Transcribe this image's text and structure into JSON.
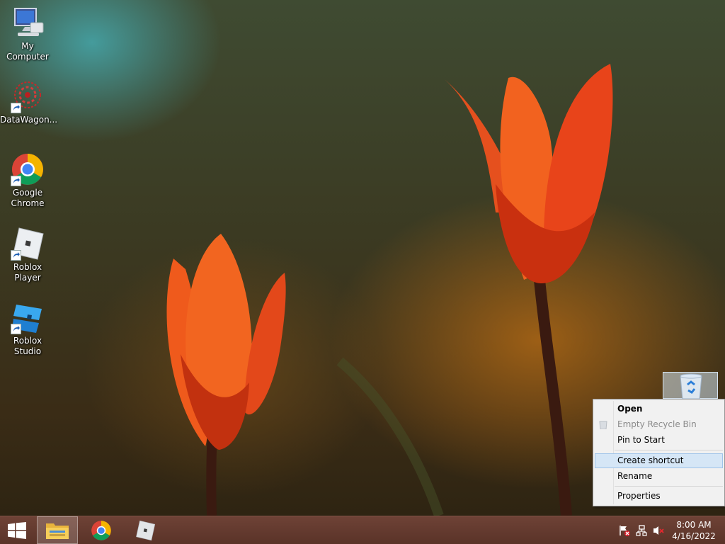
{
  "desktop_icons": [
    {
      "label": "My Computer",
      "icon": "computer-icon",
      "shortcut": false
    },
    {
      "label": "DataWagon...",
      "icon": "datawagon-icon",
      "shortcut": true
    },
    {
      "label": "Google Chrome",
      "icon": "chrome-icon",
      "shortcut": true
    },
    {
      "label": "Roblox Player",
      "icon": "roblox-player-icon",
      "shortcut": true
    },
    {
      "label": "Roblox Studio",
      "icon": "roblox-studio-icon",
      "shortcut": true
    }
  ],
  "recycle_bin": {
    "icon": "recycle-bin-icon",
    "selected": true
  },
  "context_menu": {
    "items": [
      {
        "label": "Open",
        "bold": true,
        "enabled": true
      },
      {
        "label": "Empty Recycle Bin",
        "enabled": false,
        "icon": "empty-bin-icon"
      },
      {
        "label": "Pin to Start",
        "enabled": true
      },
      {
        "label": "Create shortcut",
        "enabled": true,
        "highlighted": true
      },
      {
        "label": "Rename",
        "enabled": true
      },
      {
        "label": "Properties",
        "enabled": true
      }
    ]
  },
  "taskbar": {
    "start_icon": "windows-logo-icon",
    "pinned": [
      {
        "name": "File Explorer",
        "icon": "file-explorer-icon",
        "active": true
      },
      {
        "name": "Google Chrome",
        "icon": "chrome-icon",
        "active": false
      },
      {
        "name": "Roblox Player",
        "icon": "roblox-icon",
        "active": false
      }
    ],
    "tray_icons": [
      "action-center-flag-icon",
      "network-icon",
      "volume-muted-icon"
    ],
    "clock": {
      "time": "8:00 AM",
      "date": "4/16/2022"
    }
  },
  "colors": {
    "taskbar": "#5f372c",
    "menu_highlight": "#d5e6f6",
    "menu_background": "#f1f1f1"
  }
}
